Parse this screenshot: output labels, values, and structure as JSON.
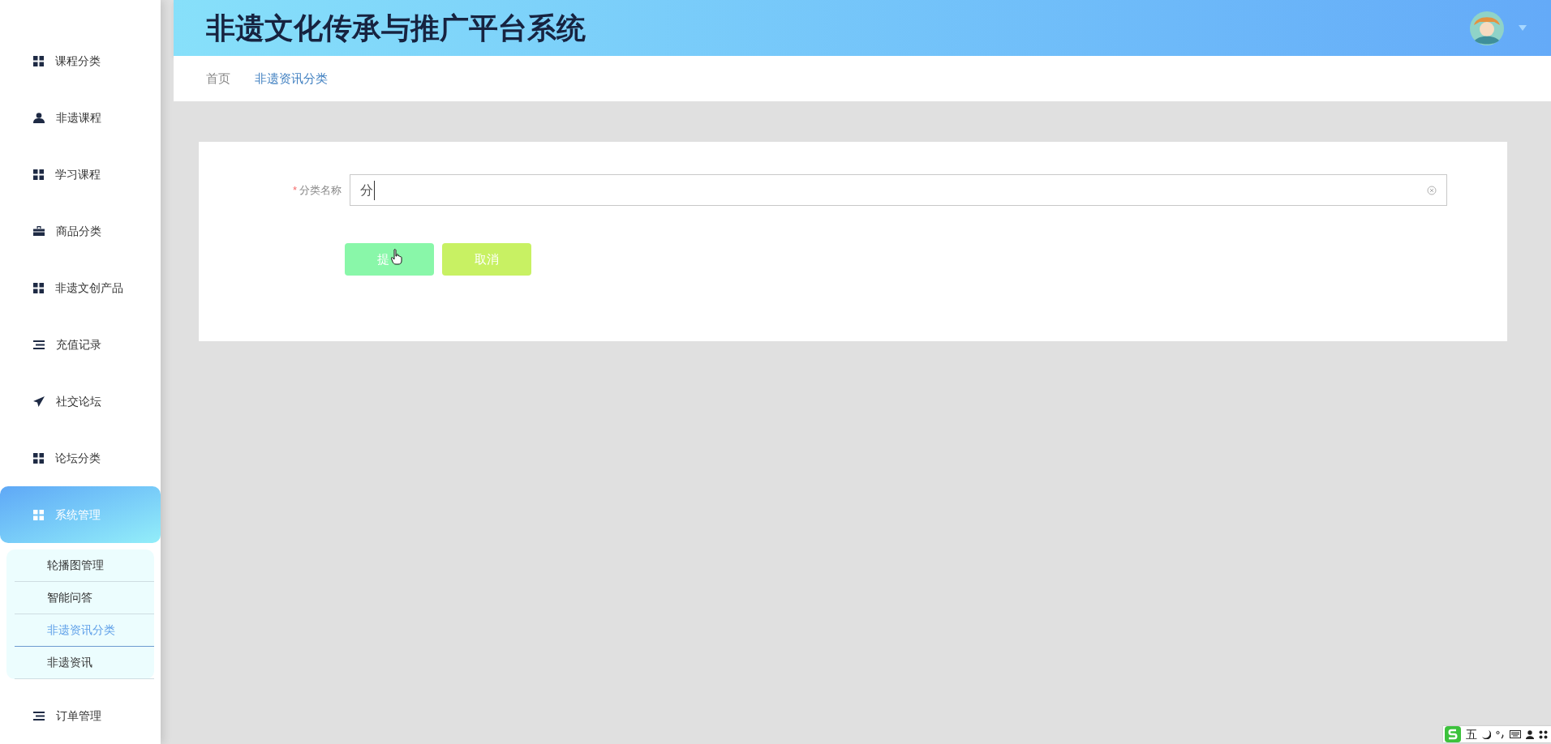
{
  "header": {
    "title": "非遗文化传承与推广平台系统"
  },
  "sidebar": {
    "items": [
      {
        "label": "课程分类",
        "kind": "grid",
        "selected": false
      },
      {
        "label": "非遗课程",
        "kind": "user",
        "selected": false
      },
      {
        "label": "学习课程",
        "kind": "grid",
        "selected": false
      },
      {
        "label": "商品分类",
        "kind": "briefcase",
        "selected": false
      },
      {
        "label": "非遗文创产品",
        "kind": "grid",
        "selected": false
      },
      {
        "label": "充值记录",
        "kind": "list",
        "selected": false
      },
      {
        "label": "社交论坛",
        "kind": "send",
        "selected": false
      },
      {
        "label": "论坛分类",
        "kind": "grid",
        "selected": false
      },
      {
        "label": "系统管理",
        "kind": "grid",
        "selected": true,
        "children": [
          {
            "label": "轮播图管理",
            "selected": false
          },
          {
            "label": "智能问答",
            "selected": false
          },
          {
            "label": "非遗资讯分类",
            "selected": true
          },
          {
            "label": "非遗资讯",
            "selected": false
          }
        ]
      },
      {
        "label": "订单管理",
        "kind": "list",
        "selected": false
      }
    ]
  },
  "breadcrumb": [
    {
      "label": "首页",
      "selected": false
    },
    {
      "label": "非遗资讯分类",
      "selected": true
    }
  ],
  "form": {
    "fields": [
      {
        "label": "分类名称",
        "required_mark": "*",
        "value": "分"
      }
    ],
    "buttons": [
      {
        "label": "提",
        "kind": "submit"
      },
      {
        "label": "取消",
        "kind": "cancel"
      }
    ]
  },
  "ime_bar": {
    "mode": "五"
  }
}
